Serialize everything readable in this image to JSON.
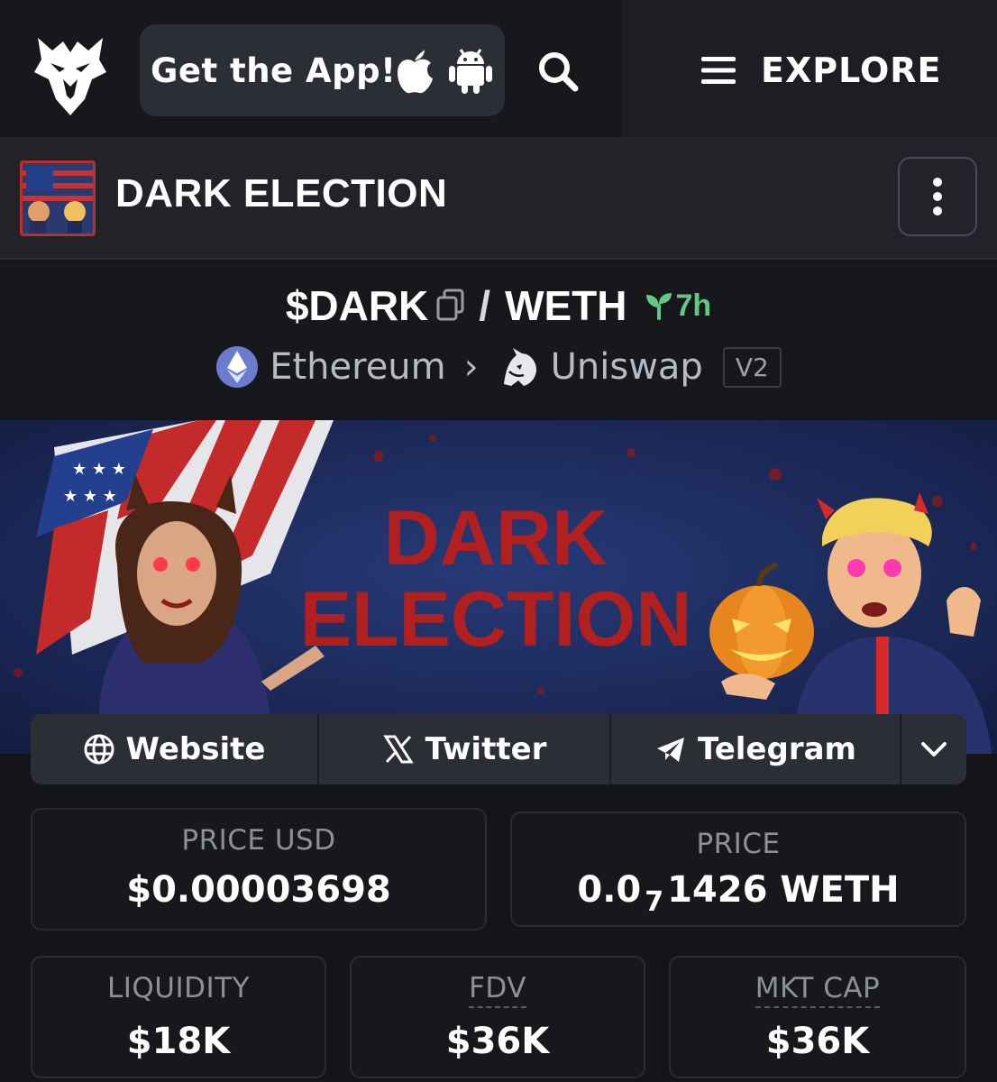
{
  "topbar": {
    "get_app_label": "Get the App!",
    "explore_label": "EXPLORE"
  },
  "token": {
    "name": "DARK ELECTION"
  },
  "pair": {
    "base_symbol": "$DARK",
    "separator": "/",
    "quote_symbol": "WETH",
    "age": "7h",
    "chain": "Ethereum",
    "dex": "Uniswap",
    "version": "V2"
  },
  "banner": {
    "title_line1": "DARK",
    "title_line2": "ELECTION"
  },
  "links": {
    "website": "Website",
    "twitter": "Twitter",
    "telegram": "Telegram"
  },
  "stats": {
    "price_usd_label": "PRICE USD",
    "price_usd_value": "$0.00003698",
    "price_label": "PRICE",
    "price_value_prefix": "0.0",
    "price_value_subscript": "7",
    "price_value_suffix": "1426 WETH",
    "liquidity_label": "LIQUIDITY",
    "liquidity_value": "$18K",
    "fdv_label": "FDV",
    "fdv_value": "$36K",
    "mktcap_label": "MKT CAP",
    "mktcap_value": "$36K"
  },
  "colors": {
    "background": "#141519",
    "panel": "#2c2e35",
    "age_green": "#62c884",
    "muted_text": "#8e9098",
    "banner_red": "#b21f1f"
  },
  "icons": [
    "eagle-logo-icon",
    "apple-icon",
    "android-icon",
    "search-icon",
    "menu-icon",
    "more-vertical-icon",
    "copy-icon",
    "seedling-icon",
    "ethereum-icon",
    "chevron-right-icon",
    "uniswap-icon",
    "globe-icon",
    "x-logo-icon",
    "telegram-icon",
    "chevron-down-icon"
  ]
}
